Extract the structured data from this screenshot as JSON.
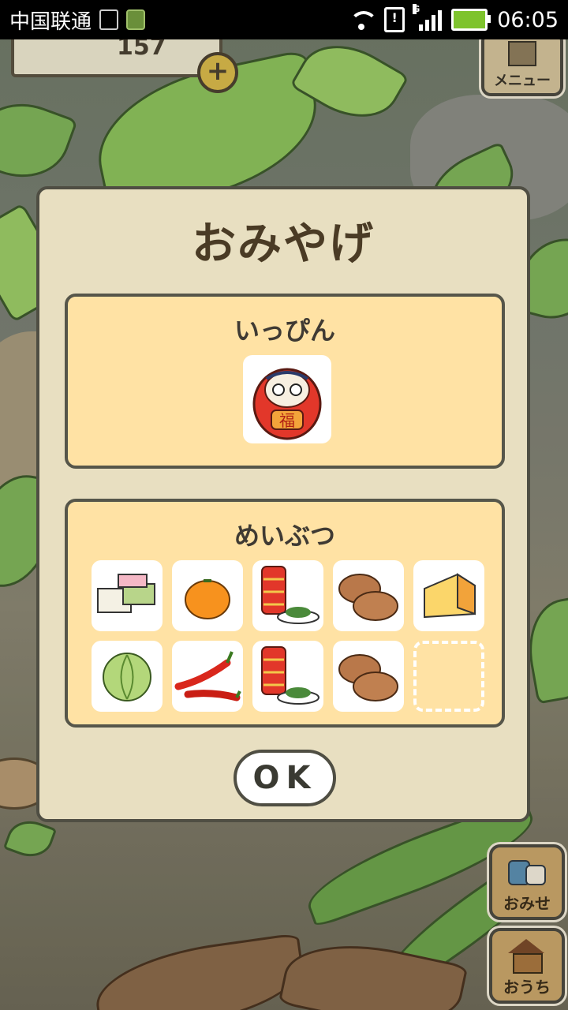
{
  "status_bar": {
    "carrier": "中国联通",
    "time": "06:05",
    "network_type": "G"
  },
  "hud": {
    "clover_count": "157",
    "menu_label": "メニュー",
    "shop_label": "おみせ",
    "home_label": "おうち"
  },
  "dialog": {
    "title": "おみやげ",
    "treasure_section": {
      "title": "いっぴん",
      "items": [
        {
          "icon": "daruma-icon",
          "label": "福"
        }
      ]
    },
    "specialty_section": {
      "title": "めいぶつ",
      "items": [
        {
          "icon": "mochi-sweets-icon"
        },
        {
          "icon": "mandarin-orange-icon"
        },
        {
          "icon": "tea-can-icon"
        },
        {
          "icon": "manju-buns-icon"
        },
        {
          "icon": "cheese-wedge-icon"
        },
        {
          "icon": "cabbage-icon"
        },
        {
          "icon": "red-peppers-icon"
        },
        {
          "icon": "tea-can-icon"
        },
        {
          "icon": "manju-buns-icon"
        },
        {
          "icon": "empty-slot"
        }
      ]
    },
    "ok_label": "OK"
  }
}
